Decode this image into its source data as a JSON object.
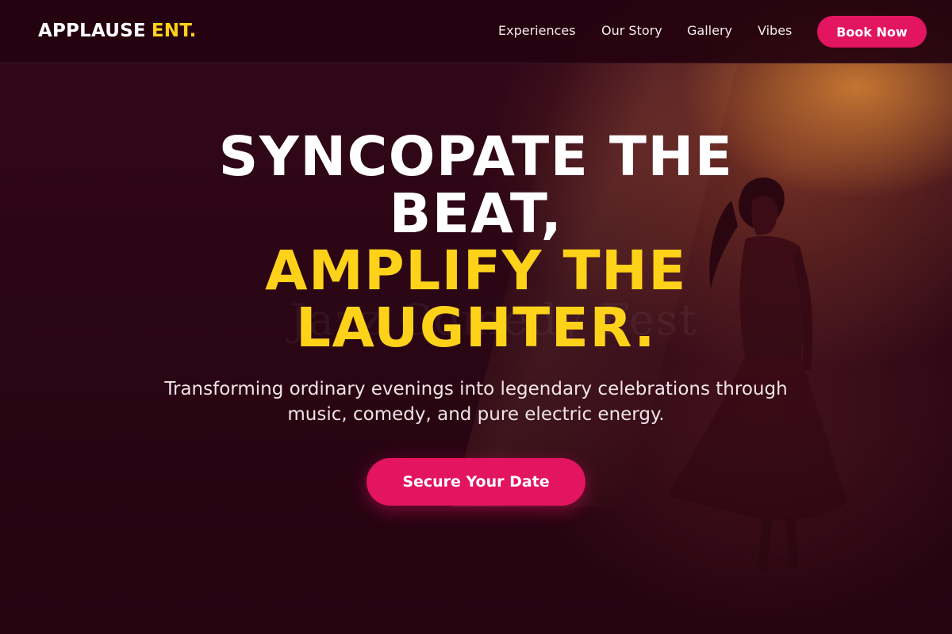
{
  "brand": {
    "name": "APPLAUSE",
    "suffix": "ENT."
  },
  "nav": {
    "items": [
      {
        "label": "Experiences"
      },
      {
        "label": "Our Story"
      },
      {
        "label": "Gallery"
      },
      {
        "label": "Vibes"
      }
    ],
    "cta_label": "Book Now"
  },
  "hero": {
    "headline_line1": "SYNCOPATE THE",
    "headline_line2": "BEAT,",
    "headline_line3": "AMPLIFY THE",
    "headline_line4": "LAUGHTER.",
    "subtitle": "Transforming ordinary evenings into legendary celebrations through music, comedy, and pure electric energy.",
    "cta_label": "Secure Your Date",
    "background_watermark": "Jazz Comedy Fest"
  },
  "colors": {
    "accent": "#e31460",
    "highlight": "#ffd21a",
    "background": "#26040f"
  }
}
